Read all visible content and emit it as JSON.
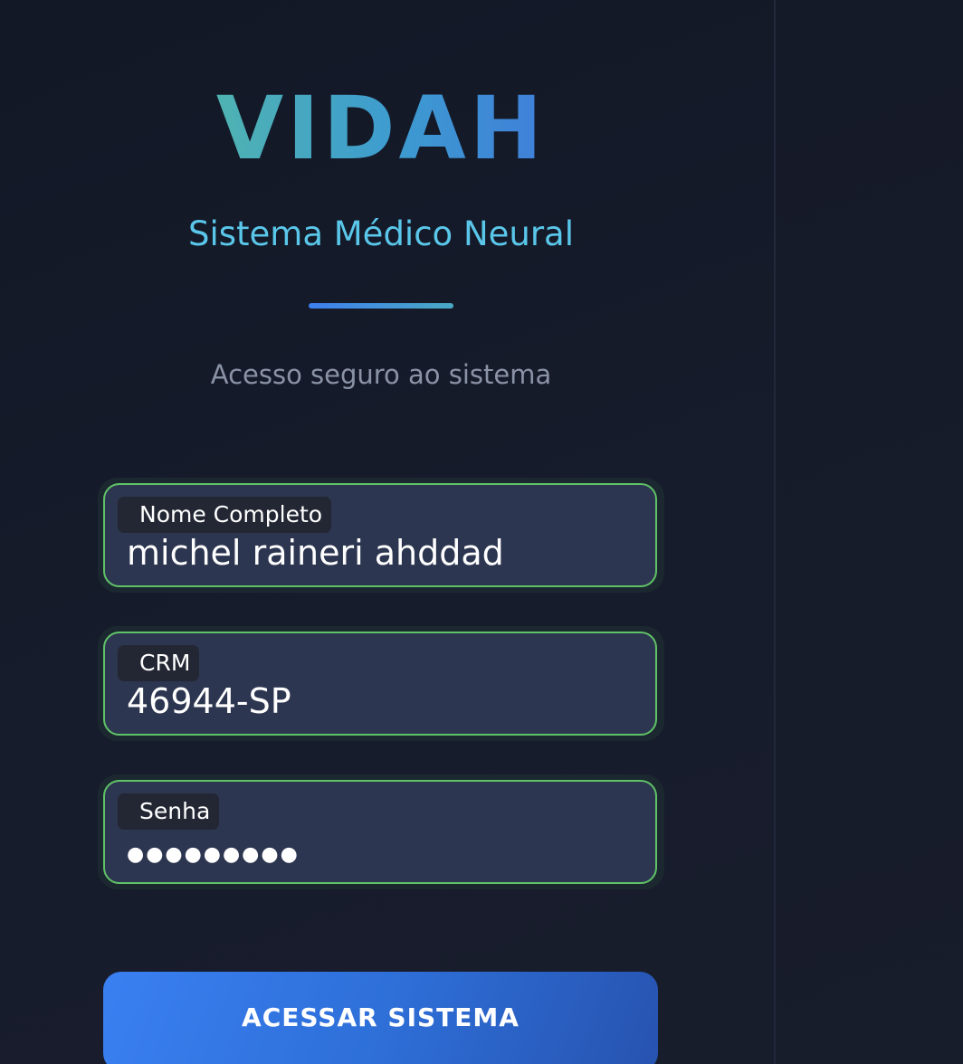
{
  "brand": {
    "logo": "VIDAH",
    "subtitle": "Sistema Médico Neural",
    "tagline": "Acesso seguro ao sistema"
  },
  "form": {
    "name_field": {
      "label": "Nome Completo",
      "value": "michel raineri ahddad"
    },
    "crm_field": {
      "label": "CRM",
      "value": "46944-SP"
    },
    "password_field": {
      "label": "Senha",
      "masked_value": "●●●●●●●●●"
    },
    "submit_label": "ACESSAR SISTEMA"
  },
  "colors": {
    "accent_green": "#5fc267",
    "accent_blue": "#3a80f2",
    "subtitle_cyan": "#5ac7ea"
  }
}
